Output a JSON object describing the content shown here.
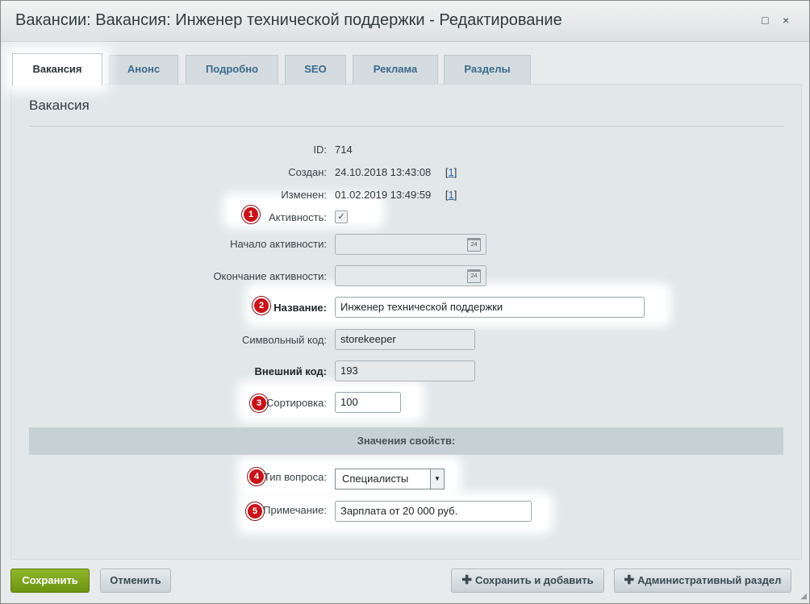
{
  "window": {
    "title": "Вакансии: Вакансия: Инженер технической поддержки - Редактирование",
    "maximize_icon": "□",
    "close_icon": "×"
  },
  "tabs": [
    {
      "label": "Вакансия",
      "active": true
    },
    {
      "label": "Анонс"
    },
    {
      "label": "Подробно"
    },
    {
      "label": "SEO"
    },
    {
      "label": "Реклама"
    },
    {
      "label": "Разделы"
    }
  ],
  "panel": {
    "title": "Вакансия",
    "fields": {
      "id": {
        "label": "ID:",
        "value": "714"
      },
      "created": {
        "label": "Создан:",
        "value": "24.10.2018 13:43:08",
        "link": "1"
      },
      "modified": {
        "label": "Изменен:",
        "value": "01.02.2019 13:49:59",
        "link": "1"
      },
      "active": {
        "label": "Активность:",
        "checked": true,
        "check_glyph": "✓"
      },
      "active_from": {
        "label": "Начало активности:",
        "value": "",
        "calendar": "24"
      },
      "active_to": {
        "label": "Окончание активности:",
        "value": "",
        "calendar": "24"
      },
      "name": {
        "label": "Название:",
        "value": "Инженер технической поддержки"
      },
      "code": {
        "label": "Символьный код:",
        "value": "storekeeper"
      },
      "external_code": {
        "label": "Внешний код:",
        "value": "193"
      },
      "sort": {
        "label": "Сортировка:",
        "value": "100"
      }
    },
    "section_title": "Значения свойств:",
    "properties": {
      "question_type": {
        "label": "Тип вопроса:",
        "value": "Специалисты",
        "arrow": "▼"
      },
      "note": {
        "label": "Примечание:",
        "value": "Зарплата от 20 000 руб."
      }
    }
  },
  "badges": [
    "1",
    "2",
    "3",
    "4",
    "5"
  ],
  "buttons": {
    "save": "Сохранить",
    "cancel": "Отменить",
    "save_add": "Сохранить и добавить",
    "admin_section": "Административный раздел",
    "plus": "✚"
  },
  "colors": {
    "accent_green": "#7aa21b",
    "badge_red": "#c8131b",
    "link_blue": "#2962a5"
  }
}
